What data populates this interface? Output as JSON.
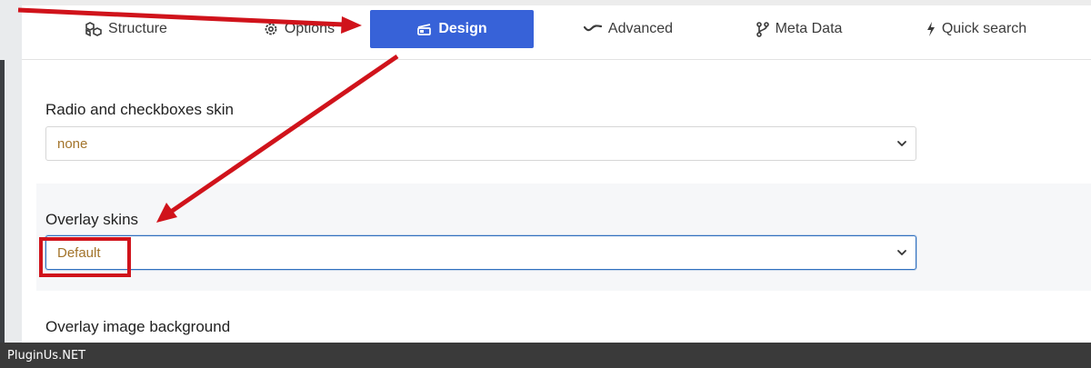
{
  "tabs": [
    {
      "label": "Structure",
      "icon": "cubes-icon"
    },
    {
      "label": "Options",
      "icon": "gear-icon"
    },
    {
      "label": "Design",
      "icon": "palette-icon",
      "active": true
    },
    {
      "label": "Advanced",
      "icon": "wave-icon"
    },
    {
      "label": "Meta Data",
      "icon": "nodes-icon"
    },
    {
      "label": "Quick search",
      "icon": "bolt-icon"
    }
  ],
  "fields": {
    "radio_skin": {
      "label": "Radio and checkboxes skin",
      "value": "none"
    },
    "overlay_skins": {
      "label": "Overlay skins",
      "value": "Default"
    },
    "overlay_background": {
      "label": "Overlay image background"
    }
  },
  "footer": {
    "text": "PluginUs.NET"
  },
  "colors": {
    "active_tab": "#3762d8",
    "annotation": "#d0131b",
    "select_value": "#a3742b"
  }
}
